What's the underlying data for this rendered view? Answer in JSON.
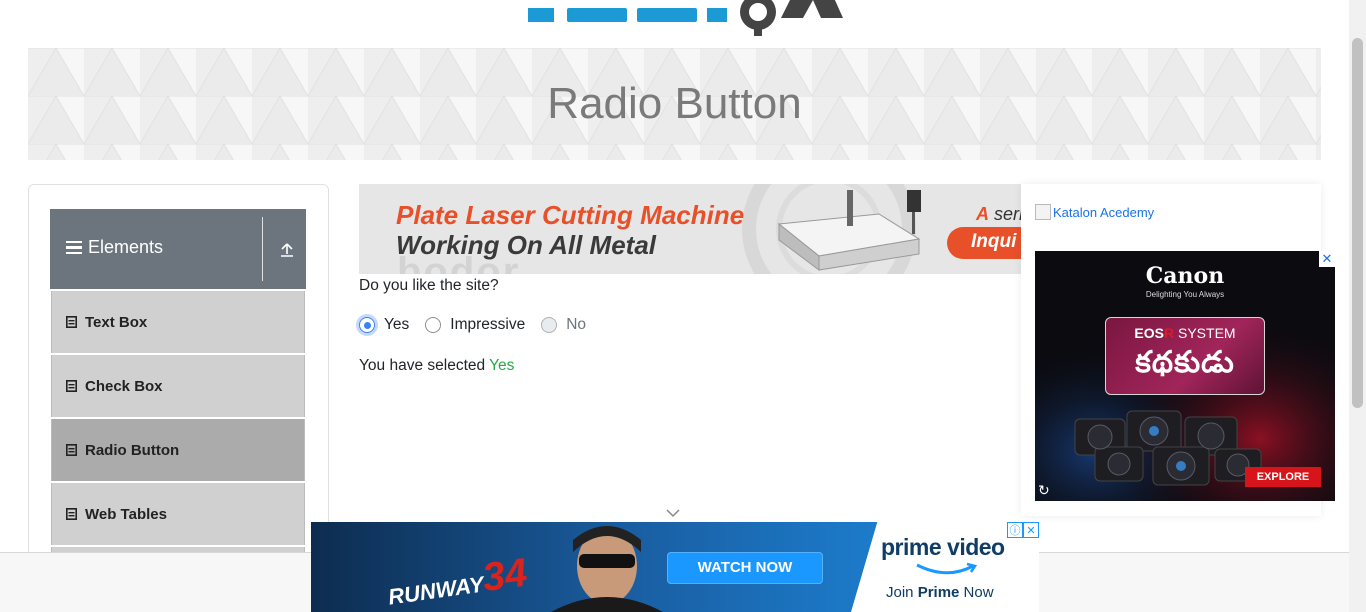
{
  "hero": {
    "title": "Radio Button"
  },
  "sidebar": {
    "group_title": "Elements",
    "items": [
      {
        "label": "Text Box"
      },
      {
        "label": "Check Box"
      },
      {
        "label": "Radio Button",
        "active": true
      },
      {
        "label": "Web Tables"
      }
    ]
  },
  "ad_top": {
    "line1": "Plate Laser Cutting Machine",
    "line2": "Working On All Metal",
    "series_prefix": "A",
    "series_rest": " seri",
    "inquiry": "Inqui",
    "watermark": "bodor"
  },
  "main": {
    "question": "Do you like the site?",
    "options": [
      {
        "label": "Yes",
        "checked": true,
        "disabled": false
      },
      {
        "label": "Impressive",
        "checked": false,
        "disabled": false
      },
      {
        "label": "No",
        "checked": false,
        "disabled": true
      }
    ],
    "result_prefix": "You have selected ",
    "result_value": "Yes"
  },
  "right_ad": {
    "link_text": "Katalon Acedemy",
    "canon": {
      "brand": "Canon",
      "tagline": "Delighting You Always",
      "eos_prefix": "EOS",
      "eos_r": "R",
      "eos_suffix": " SYSTEM",
      "telugu": "కథకుడు",
      "explore": "EXPLORE",
      "close": "✕"
    }
  },
  "bottom_ad": {
    "title_left": "RUNWAY",
    "title_num": "34",
    "watch": "WATCH NOW",
    "brand": "prime video",
    "join_prefix": "Join ",
    "join_bold": "Prime",
    "join_suffix": " Now"
  },
  "colors": {
    "accent_blue": "#3b82f6",
    "success_green": "#28a745",
    "sidebar_header": "#6c757d",
    "menu_item": "#d0d0d0",
    "menu_item_active": "#ababab"
  }
}
